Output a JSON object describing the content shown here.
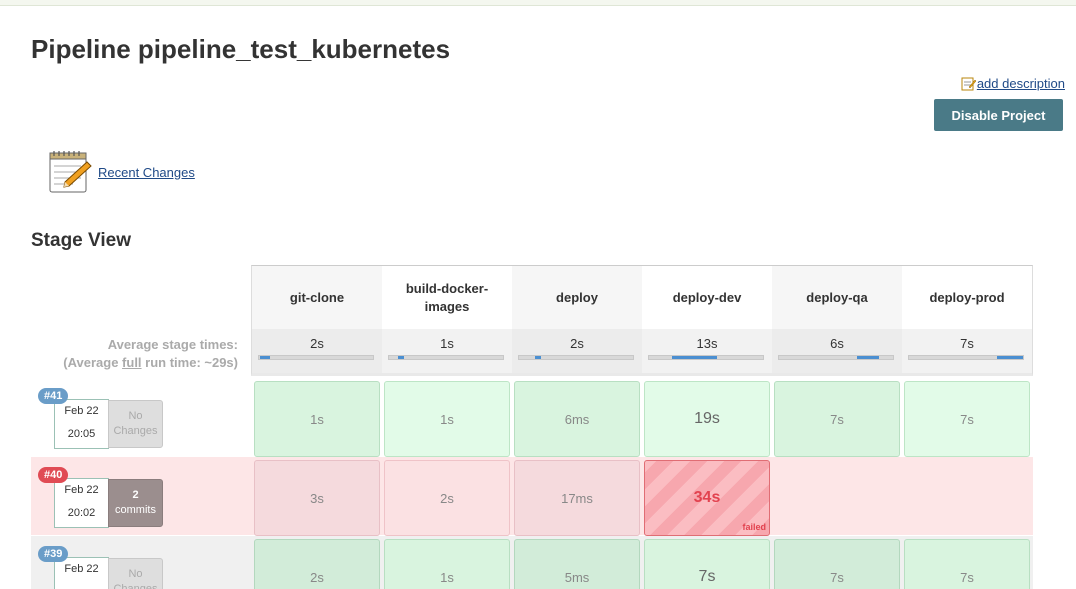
{
  "page": {
    "title": "Pipeline pipeline_test_kubernetes"
  },
  "actions": {
    "add_description": "add description",
    "disable_project": "Disable Project",
    "recent_changes": "Recent Changes"
  },
  "stage_view": {
    "title": "Stage View",
    "avg_label_line1": "Average stage times:",
    "avg_label_pre": "(Average ",
    "avg_label_link": "full",
    "avg_label_post": " run time: ~29s)",
    "stages": [
      {
        "name": "git-clone",
        "avg": "2s",
        "avg_bar_fraction": 0.09
      },
      {
        "name": "build-docker-images",
        "avg": "1s",
        "avg_bar_fraction": 0.05
      },
      {
        "name": "deploy",
        "avg": "2s",
        "avg_bar_fraction": 0.05
      },
      {
        "name": "deploy-dev",
        "avg": "13s",
        "avg_bar_fraction": 0.4
      },
      {
        "name": "deploy-qa",
        "avg": "6s",
        "avg_bar_fraction": 0.2
      },
      {
        "name": "deploy-prod",
        "avg": "7s",
        "avg_bar_fraction": 0.23
      }
    ],
    "runs": [
      {
        "id": "#41",
        "badge_color": "#6a9dc8",
        "date": "Feb 22",
        "time": "20:05",
        "changes_line1": "No",
        "changes_line2": "Changes",
        "status": "success",
        "durations": [
          "1s",
          "1s",
          "6ms",
          "19s",
          "7s",
          "7s"
        ]
      },
      {
        "id": "#40",
        "badge_color": "#e04b54",
        "date": "Feb 22",
        "time": "20:02",
        "changes_line1": "2",
        "changes_line2": "commits",
        "status": "failed",
        "durations": [
          "3s",
          "2s",
          "17ms",
          "34s",
          "",
          ""
        ],
        "failed_label": "failed"
      },
      {
        "id": "#39",
        "badge_color": "#6a9dc8",
        "date": "Feb 22",
        "time": "",
        "changes_line1": "No",
        "changes_line2": "Changes",
        "status": "success",
        "durations": [
          "2s",
          "1s",
          "5ms",
          "7s",
          "7s",
          "7s"
        ]
      }
    ]
  }
}
